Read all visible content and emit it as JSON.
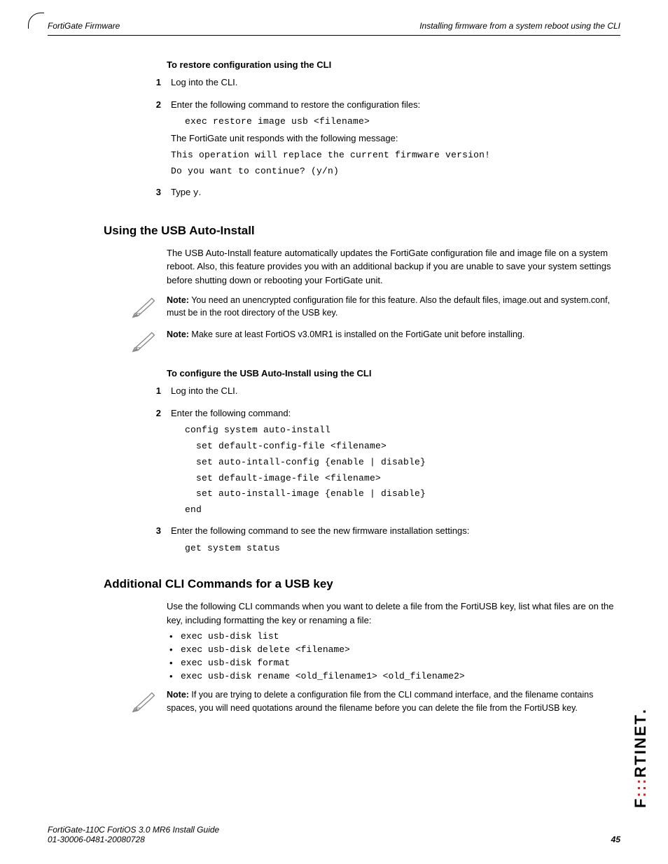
{
  "header": {
    "left": "FortiGate Firmware",
    "right": "Installing firmware from a system reboot using the CLI"
  },
  "s1": {
    "headproc": "To restore configuration using the CLI",
    "step1": "Log into the CLI.",
    "step2": "Enter the following command to restore the configuration files:",
    "cmd1": "exec restore image usb <filename>",
    "resp": "The FortiGate unit responds with the following message:",
    "out1": "This operation will replace the current firmware version!",
    "out2": "Do you want to continue? (y/n)",
    "step3a": "Type ",
    "step3b": "y",
    "step3c": "."
  },
  "h2a": "Using the USB Auto-Install",
  "para1": "The USB Auto-Install feature automatically updates the FortiGate configuration file and image file on a system reboot. Also, this feature provides you with an additional backup if you are unable to save your system settings before shutting down or rebooting your FortiGate unit.",
  "notelabel": "Note:",
  "note1": " You need an unencrypted configuration file for this feature. Also the default files, image.out and system.conf, must be in the root directory of the USB key.",
  "note2": " Make sure at least FortiOS v3.0MR1 is installed on the FortiGate unit before installing.",
  "s2": {
    "headproc": "To configure the USB Auto-Install using the CLI",
    "step1": "Log into the CLI.",
    "step2": "Enter the following command:",
    "c1": "config system auto-install",
    "c2": "  set default-config-file <filename>",
    "c3": "  set auto-intall-config {enable | disable}",
    "c4": "  set default-image-file <filename>",
    "c5": "  set auto-install-image {enable | disable}",
    "c6": "end",
    "step3": "Enter the following command to see the new firmware installation settings:",
    "c7": "get system status"
  },
  "h2b": "Additional CLI Commands for a USB key",
  "para2": "Use the following CLI commands when you want to delete a file from the FortiUSB key, list what files are on the key, including formatting the key or renaming a file:",
  "b1": "exec usb-disk list",
  "b2": "exec usb-disk delete <filename>",
  "b3": "exec usb-disk format",
  "b4": "exec usb-disk rename <old_filename1> <old_filename2>",
  "note3": " If you are trying to delete a configuration file from the CLI command interface, and the filename contains spaces, you will need quotations around the filename before you can delete the file from the FortiUSB key.",
  "footer": {
    "l1": "FortiGate-110C FortiOS 3.0 MR6 Install Guide",
    "l2": "01-30006-0481-20080728",
    "page": "45"
  },
  "brand": {
    "a": "F",
    "b": "RTINET"
  }
}
